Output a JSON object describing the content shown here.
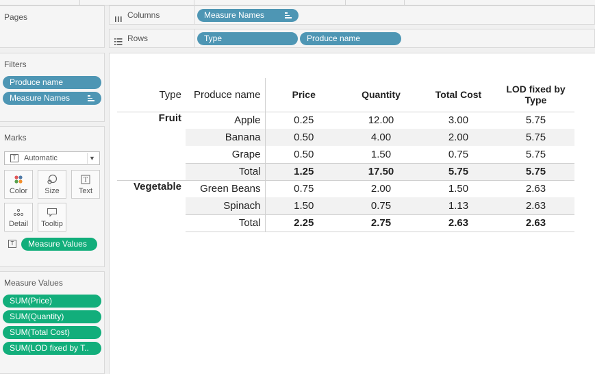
{
  "pages": {
    "title": "Pages"
  },
  "shelves": {
    "columns": {
      "label": "Columns",
      "pills": [
        "Measure Names"
      ]
    },
    "rows": {
      "label": "Rows",
      "pills": [
        "Type",
        "Produce name"
      ]
    }
  },
  "filters": {
    "title": "Filters",
    "pills": [
      "Produce name",
      "Measure Names"
    ]
  },
  "marks": {
    "title": "Marks",
    "mark_type": "Automatic",
    "buttons": [
      "Color",
      "Size",
      "Text",
      "Detail",
      "Tooltip"
    ],
    "text_pill": "Measure Values"
  },
  "measure_values": {
    "title": "Measure Values",
    "pills": [
      "SUM(Price)",
      "SUM(Quantity)",
      "SUM(Total Cost)",
      "SUM(LOD fixed by T.."
    ]
  },
  "crosstab": {
    "headers": {
      "type": "Type",
      "produce": "Produce name",
      "price": "Price",
      "quantity": "Quantity",
      "total_cost": "Total Cost",
      "lod_line1": "LOD fixed by",
      "lod_line2": "Type"
    },
    "groups": [
      {
        "type": "Fruit",
        "rows": [
          {
            "name": "Apple",
            "price": "0.25",
            "quantity": "12.00",
            "total_cost": "3.00",
            "lod": "5.75"
          },
          {
            "name": "Banana",
            "price": "0.50",
            "quantity": "4.00",
            "total_cost": "2.00",
            "lod": "5.75"
          },
          {
            "name": "Grape",
            "price": "0.50",
            "quantity": "1.50",
            "total_cost": "0.75",
            "lod": "5.75"
          }
        ],
        "total": {
          "name": "Total",
          "price": "1.25",
          "quantity": "17.50",
          "total_cost": "5.75",
          "lod": "5.75"
        }
      },
      {
        "type": "Vegetable",
        "rows": [
          {
            "name": "Green Beans",
            "price": "0.75",
            "quantity": "2.00",
            "total_cost": "1.50",
            "lod": "2.63"
          },
          {
            "name": "Spinach",
            "price": "1.50",
            "quantity": "0.75",
            "total_cost": "1.13",
            "lod": "2.63"
          }
        ],
        "total": {
          "name": "Total",
          "price": "2.25",
          "quantity": "2.75",
          "total_cost": "2.63",
          "lod": "2.63"
        }
      }
    ]
  },
  "colors": {
    "dimension_pill": "#4e96b4",
    "measure_pill": "#12ae7b",
    "row_band": "#f2f2f2"
  }
}
